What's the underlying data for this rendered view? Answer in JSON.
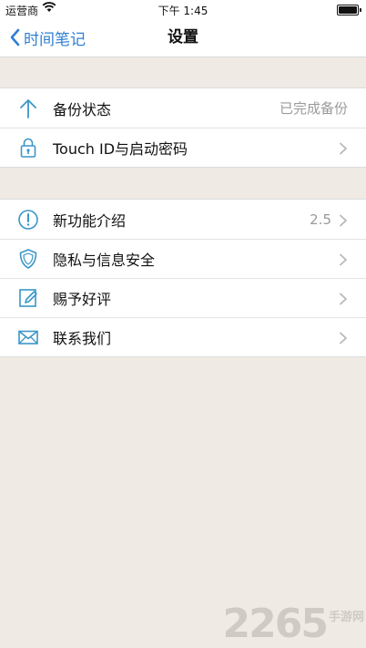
{
  "status_bar": {
    "carrier": "运营商",
    "time": "下午 1:45"
  },
  "nav": {
    "back_label": "时间笔记",
    "title": "设置"
  },
  "groups": [
    {
      "rows": [
        {
          "label": "备份状态",
          "value": "已完成备份",
          "icon": "upload-arrow-icon",
          "chevron": false
        },
        {
          "label": "Touch ID与启动密码",
          "value": "",
          "icon": "padlock-icon",
          "chevron": true
        }
      ]
    },
    {
      "rows": [
        {
          "label": "新功能介绍",
          "value": "2.5",
          "icon": "exclamation-circle-icon",
          "chevron": true
        },
        {
          "label": "隐私与信息安全",
          "value": "",
          "icon": "shield-icon",
          "chevron": true
        },
        {
          "label": "赐予好评",
          "value": "",
          "icon": "edit-pen-icon",
          "chevron": true
        },
        {
          "label": "联系我们",
          "value": "",
          "icon": "envelope-icon",
          "chevron": true
        }
      ]
    }
  ],
  "watermark": {
    "number": "2265",
    "suffix": "手游网"
  },
  "colors": {
    "accent": "#2f7fd3",
    "icon": "#3a96c9",
    "background": "#efebe4",
    "secondary_text": "#9a9a9a"
  }
}
